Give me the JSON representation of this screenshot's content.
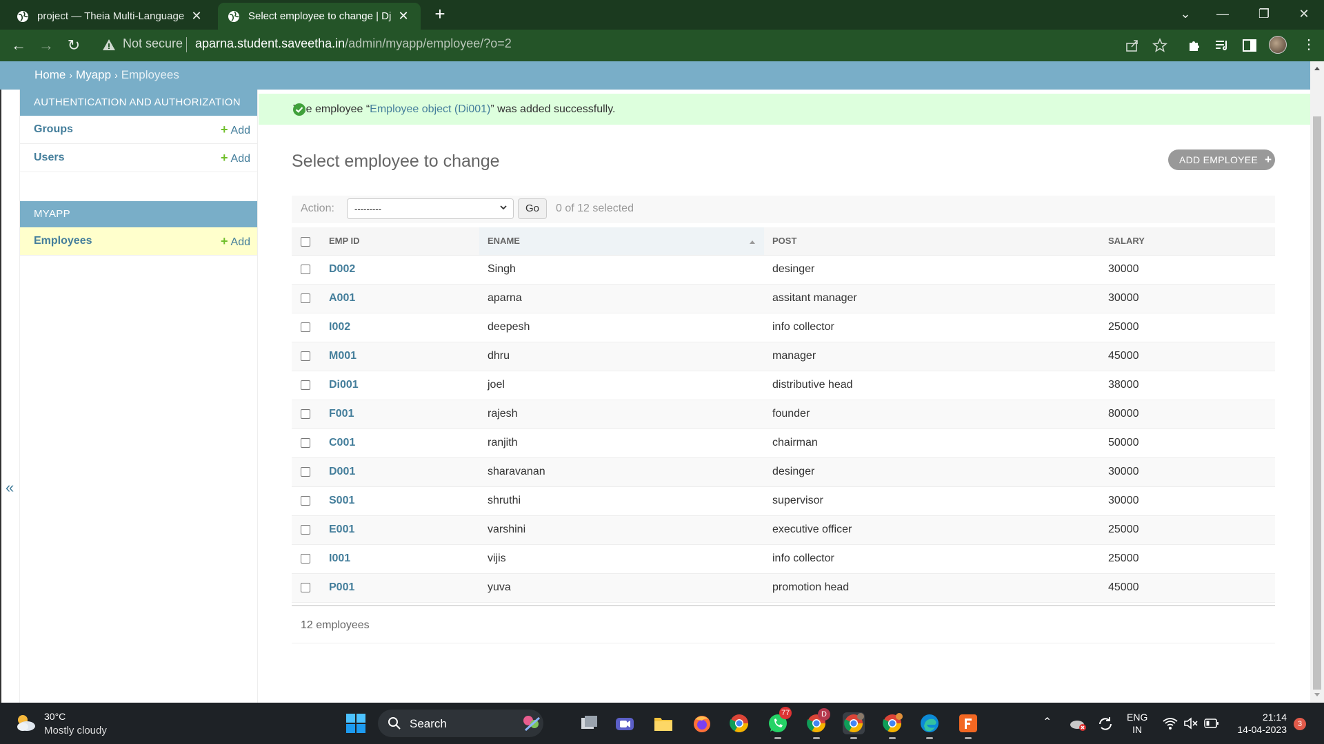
{
  "browser": {
    "tabs": [
      {
        "title": "project — Theia Multi-Language",
        "active": false
      },
      {
        "title": "Select employee to change | Djan",
        "active": true
      }
    ],
    "address": {
      "security_label": "Not secure",
      "host": "aparna.student.saveetha.in",
      "path": "/admin/myapp/employee/?o=2"
    }
  },
  "breadcrumbs": {
    "home": "Home",
    "sep1": "›",
    "app": "Myapp",
    "sep2": "›",
    "current": "Employees"
  },
  "sidebar": {
    "modules": [
      {
        "caption": "Authentication and Authorization",
        "models": [
          {
            "label": "Groups",
            "add": "Add"
          },
          {
            "label": "Users",
            "add": "Add"
          }
        ]
      },
      {
        "caption": "Myapp",
        "models": [
          {
            "label": "Employees",
            "add": "Add",
            "current": true
          }
        ]
      }
    ],
    "collapse_glyph": "«"
  },
  "message": {
    "prefix": "The employee “",
    "link": "Employee object (Di001)",
    "suffix": "” was added successfully."
  },
  "page": {
    "title": "Select employee to change",
    "add_button": "ADD EMPLOYEE",
    "add_button_icon": "+"
  },
  "actions": {
    "label": "Action:",
    "selected_option": "---------",
    "go_label": "Go",
    "selection_counter": "0 of 12 selected"
  },
  "table": {
    "columns": [
      "EMP ID",
      "ENAME",
      "POST",
      "SALARY"
    ],
    "sorted_column": "ENAME",
    "rows": [
      {
        "emp_id": "D002",
        "ename": "Singh",
        "post": "desinger",
        "salary": "30000"
      },
      {
        "emp_id": "A001",
        "ename": "aparna",
        "post": "assitant manager",
        "salary": "30000"
      },
      {
        "emp_id": "I002",
        "ename": "deepesh",
        "post": "info collector",
        "salary": "25000"
      },
      {
        "emp_id": "M001",
        "ename": "dhru",
        "post": "manager",
        "salary": "45000"
      },
      {
        "emp_id": "Di001",
        "ename": "joel",
        "post": "distributive head",
        "salary": "38000"
      },
      {
        "emp_id": "F001",
        "ename": "rajesh",
        "post": "founder",
        "salary": "80000"
      },
      {
        "emp_id": "C001",
        "ename": "ranjith",
        "post": "chairman",
        "salary": "50000"
      },
      {
        "emp_id": "D001",
        "ename": "sharavanan",
        "post": "desinger",
        "salary": "30000"
      },
      {
        "emp_id": "S001",
        "ename": "shruthi",
        "post": "supervisor",
        "salary": "30000"
      },
      {
        "emp_id": "E001",
        "ename": "varshini",
        "post": "executive officer",
        "salary": "25000"
      },
      {
        "emp_id": "I001",
        "ename": "vijis",
        "post": "info collector",
        "salary": "25000"
      },
      {
        "emp_id": "P001",
        "ename": "yuva",
        "post": "promotion head",
        "salary": "45000"
      }
    ]
  },
  "paginator": {
    "text": "12 employees"
  },
  "taskbar": {
    "weather": {
      "temp": "30°C",
      "condition": "Mostly cloudy",
      "icon": "cloud-sun-icon"
    },
    "search_label": "Search",
    "apps": [
      "task-view",
      "meet",
      "file-explorer",
      "firefox",
      "chrome",
      "whatsapp",
      "chrome-profile-d",
      "chrome-profile-active",
      "chrome-profile-2",
      "edge",
      "foxit"
    ],
    "whatsapp_badge": "77",
    "chrome_badge": "D",
    "lang_line1": "ENG",
    "lang_line2": "IN",
    "time": "21:14",
    "date": "14-04-2023",
    "notification_count": "3"
  },
  "colors": {
    "chrome_dark": "#1b3a1f",
    "chrome_toolbar": "#245428",
    "django_header": "#79aec8",
    "django_link": "#447e9b",
    "success_bg": "#dddddd",
    "add_green": "#70bf2b"
  }
}
